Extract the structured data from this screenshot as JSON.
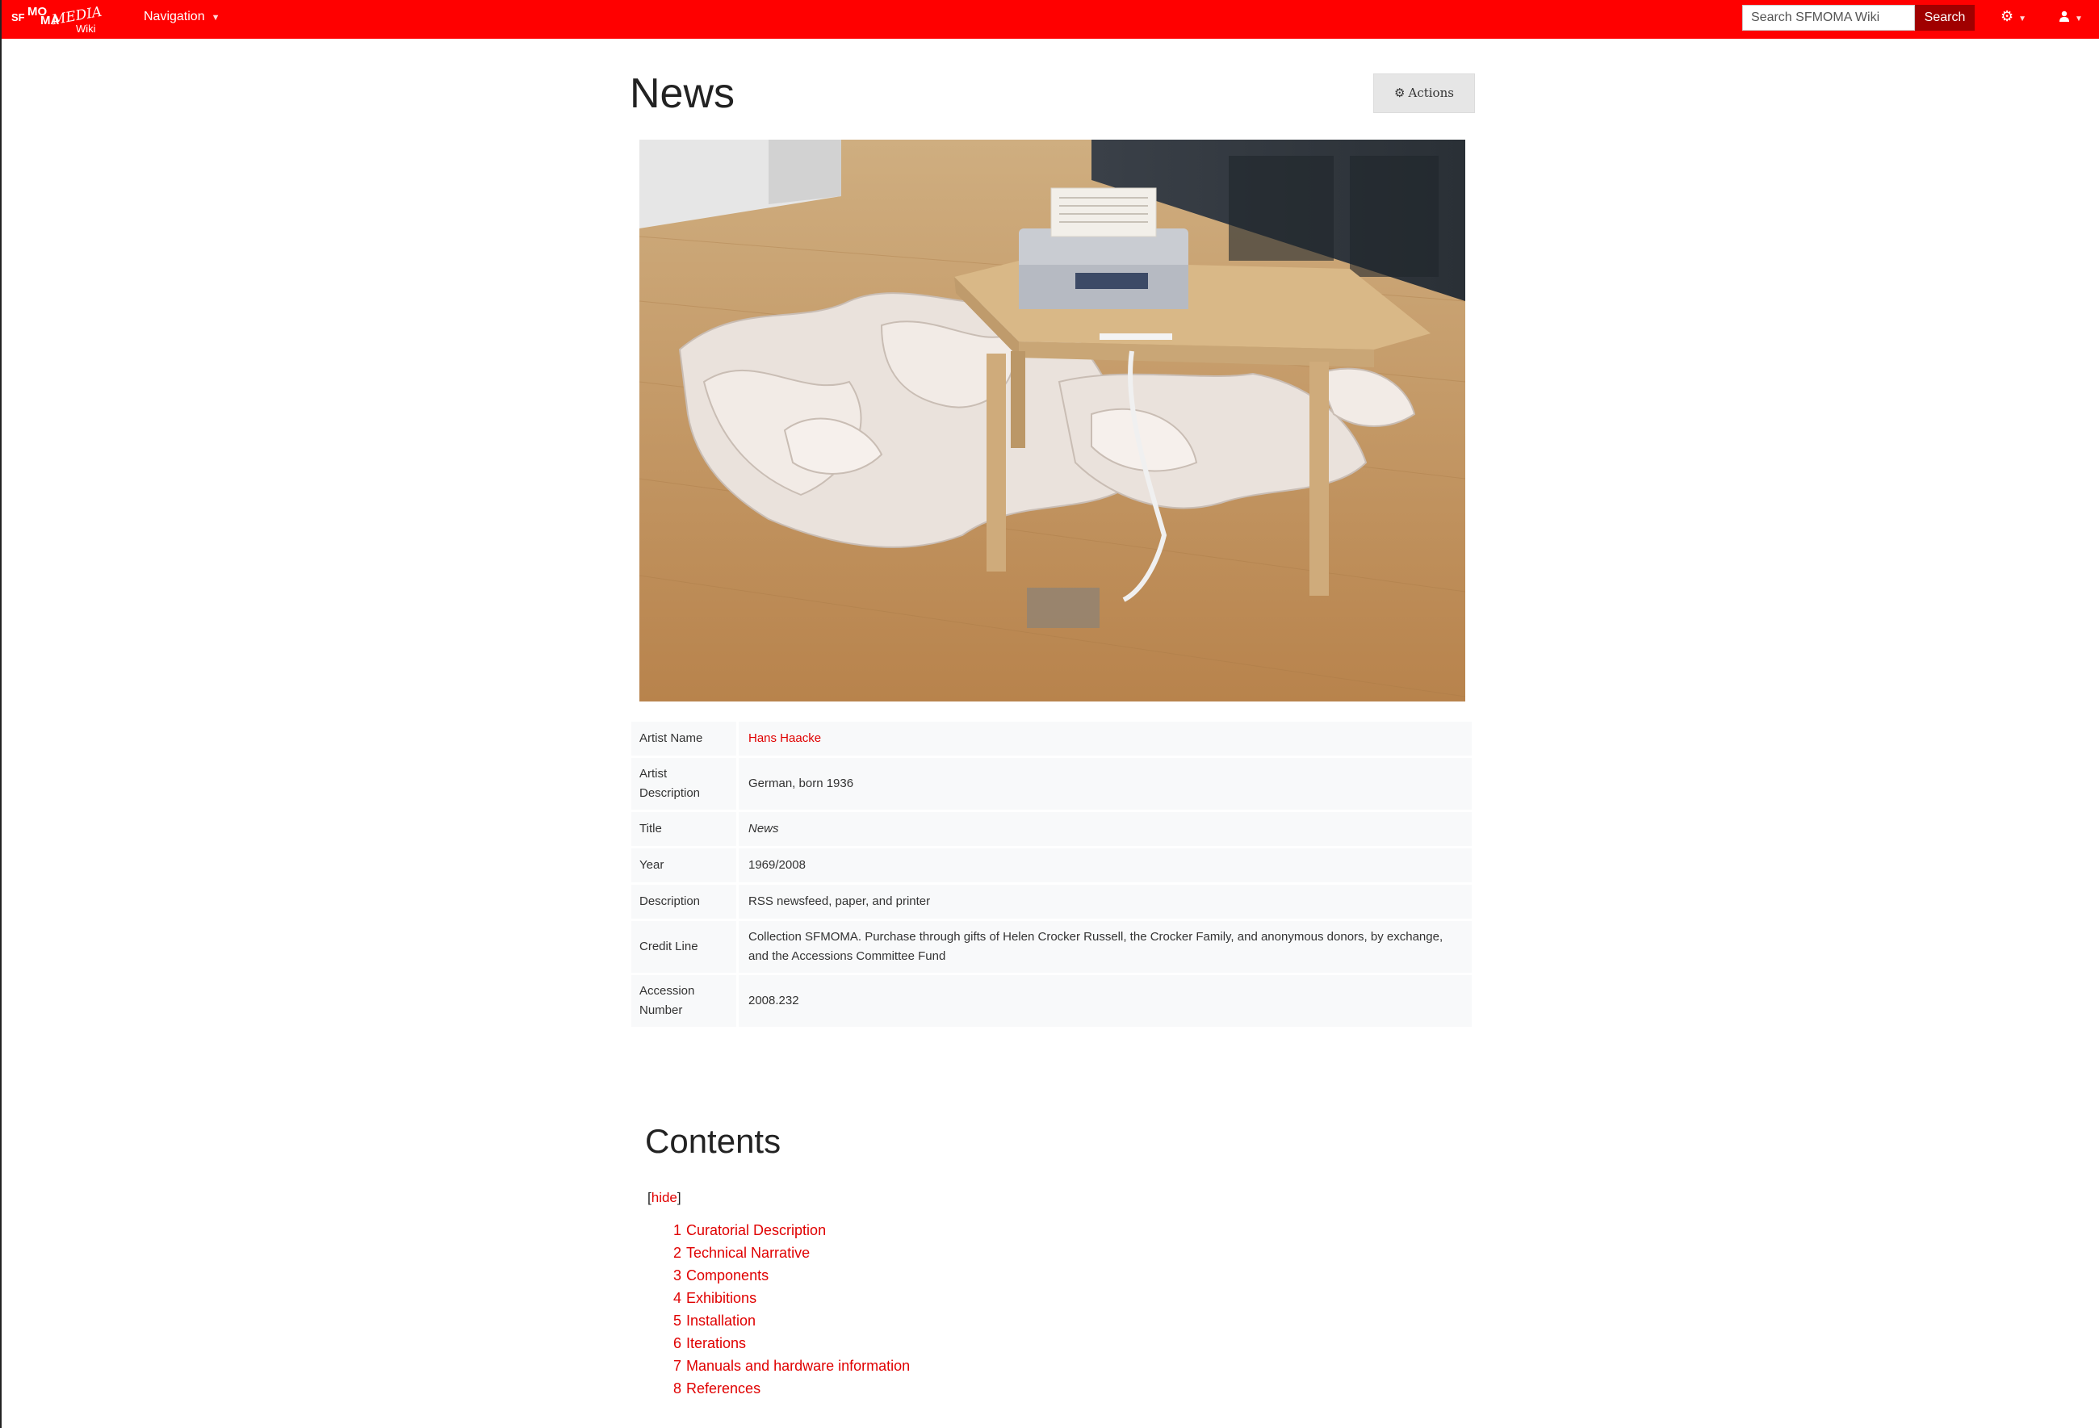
{
  "navbar": {
    "logo": {
      "sf": "SF",
      "mo": "MO",
      "ma": "MA",
      "media": "MEDIA",
      "wiki": "Wiki"
    },
    "navigation_label": "Navigation",
    "search_placeholder": "Search SFMOMA Wiki",
    "search_button": "Search",
    "tools_icon": "cogs-icon",
    "user_icon": "user-icon"
  },
  "page": {
    "title": "News",
    "actions_label": "Actions",
    "actions_icon": "gear-icon"
  },
  "image": {
    "subject": "printer on wooden table with paper spilling onto floor"
  },
  "info_table": {
    "rows": [
      {
        "key": "Artist Name",
        "value": "Hans Haacke"
      },
      {
        "key": "Artist Description",
        "value": "German, born 1936"
      },
      {
        "key": "Title",
        "value": "News"
      },
      {
        "key": "Year",
        "value": "1969/2008"
      },
      {
        "key": "Description",
        "value": "RSS newsfeed, paper, and printer"
      },
      {
        "key": "Credit Line",
        "value": "Collection SFMOMA. Purchase through gifts of Helen Crocker Russell, the Crocker Family, and anonymous donors, by exchange, and the Accessions Committee Fund"
      },
      {
        "key": "Accession Number",
        "value": "2008.232"
      }
    ]
  },
  "toc": {
    "title": "Contents",
    "toggle_open": "[",
    "toggle_label": "hide",
    "toggle_close": "]",
    "items": [
      {
        "num": "1",
        "label": "Curatorial Description"
      },
      {
        "num": "2",
        "label": "Technical Narrative"
      },
      {
        "num": "3",
        "label": "Components"
      },
      {
        "num": "4",
        "label": "Exhibitions"
      },
      {
        "num": "5",
        "label": "Installation"
      },
      {
        "num": "6",
        "label": "Iterations"
      },
      {
        "num": "7",
        "label": "Manuals and hardware information"
      },
      {
        "num": "8",
        "label": "References"
      }
    ]
  },
  "colors": {
    "brand_red": "#ff0000",
    "search_button": "#a00000",
    "link": "#e00000"
  }
}
